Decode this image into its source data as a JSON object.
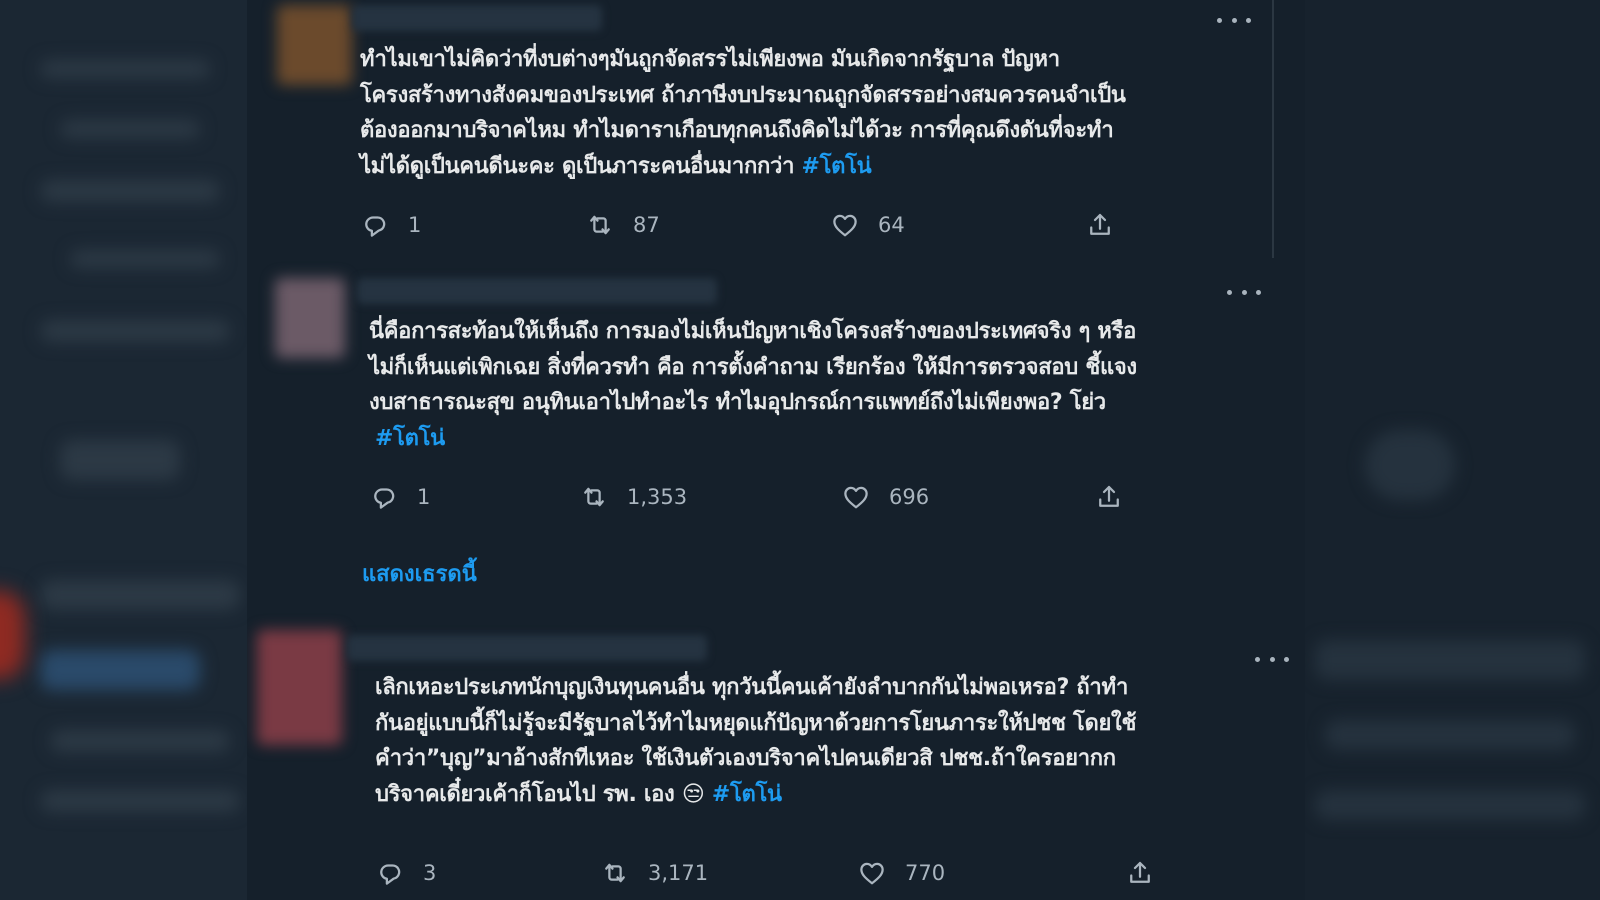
{
  "colors": {
    "background": "#15202b",
    "text": "#e7e9ea",
    "secondary_text": "#aab5bf",
    "link": "#1d9bf0"
  },
  "tweets": [
    {
      "lines": [
        "ทำไมเขาไม่คิดว่าที่งบต่างๆมันถูกจัดสรรไม่เพียงพอ มันเกิดจากรัฐบาล ปัญหา",
        "โครงสร้างทางสังคมของประเทศ ถ้าภาษีงบประมาณถูกจัดสรรอย่างสมควรคนจำเป็น",
        "ต้องออกมาบริจาคไหม ทำไมดาราเกือบทุกคนถึงคิดไม่ได้วะ  การที่คุณดึงดันที่จะทำ",
        "ไม่ได้ดูเป็นคนดีนะคะ ดูเป็นภาระคนอื่นมากกว่า "
      ],
      "hashtag": "#โตโน่",
      "reply_count": "1",
      "retweet_count": "87",
      "like_count": "64"
    },
    {
      "lines": [
        "นี่คือการสะท้อนให้เห็นถึง การมองไม่เห็นปัญหาเชิงโครงสร้างของประเทศจริง ๆ หรือ",
        "ไม่ก็เห็นแต่เพิกเฉย สิ่งที่ควรทำ คือ การตั้งคำถาม เรียกร้อง ให้มีการตรวจสอบ ชี้แจง",
        "งบสาธารณะสุข อนุทินเอาไปทำอะไร ทำไมอุปกรณ์การแพทย์ถึงไม่เพียงพอ? โย่ว",
        ""
      ],
      "hashtag": "#โตโน่",
      "reply_count": "1",
      "retweet_count": "1,353",
      "like_count": "696"
    },
    {
      "lines": [
        "เลิกเหอะประเภทนักบุญเงินทุนคนอื่น ทุกวันนี้คนเค้ายังลำบากกันไม่พอเหรอ? ถ้าทำ",
        "กันอยู่แบบนี้ก็ไม่รู้จะมีรัฐบาลไว้ทำไมหยุดแก้ปัญหาด้วยการโยนภาระให้ปชช โดยใช้",
        "คำว่า”บุญ”มาอ้างสักทีเหอะ ใช้เงินตัวเองบริจาคไปคนเดียวสิ ปชช.ถ้าใครอยากก",
        "บริจาคเดี๋ยวเค้าก็โอนไป รพ. เอง "
      ],
      "emoji": "😒",
      "hashtag": "#โตโน่",
      "reply_count": "3",
      "retweet_count": "3,171",
      "like_count": "770"
    }
  ],
  "show_thread_label": "แสดงเธรดนี้",
  "icons": [
    "reply-icon",
    "retweet-icon",
    "like-icon",
    "share-icon",
    "more-icon"
  ]
}
